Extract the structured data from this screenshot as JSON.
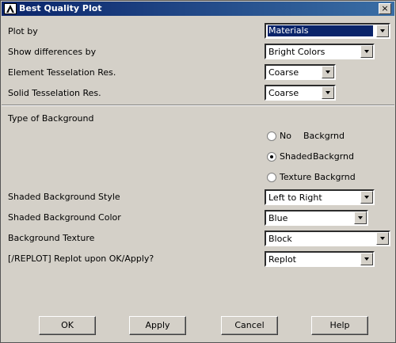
{
  "window": {
    "title": "Best Quality Plot",
    "close_glyph": "×"
  },
  "rows": {
    "plot_by": {
      "label": "Plot by",
      "value": "Materials"
    },
    "show_diff": {
      "label": "Show differences by",
      "value": "Bright Colors"
    },
    "elem_tess": {
      "label": "Element Tesselation Res.",
      "value": "Coarse"
    },
    "solid_tess": {
      "label": "Solid Tesselation Res.",
      "value": "Coarse"
    },
    "bg_type": {
      "label": "Type of Background"
    },
    "shaded_style": {
      "label": "Shaded Background Style",
      "value": "Left to Right"
    },
    "shaded_color": {
      "label": "Shaded Background Color",
      "value": "Blue"
    },
    "bg_texture": {
      "label": "Background Texture",
      "value": "Block"
    },
    "replot": {
      "label": "[/REPLOT] Replot upon OK/Apply?",
      "value": "Replot"
    }
  },
  "radios": [
    {
      "label": "No",
      "label2": "Backgrnd",
      "checked": false
    },
    {
      "label": "Shaded",
      "label2": "Backgrnd",
      "checked": true
    },
    {
      "label": "Texture Backgrnd",
      "label2": "",
      "checked": false
    }
  ],
  "buttons": {
    "ok": "OK",
    "apply": "Apply",
    "cancel": "Cancel",
    "help": "Help"
  },
  "colors": {
    "titlebar": "#0a246a",
    "dialog_bg": "#d4d0c8",
    "selection": "#0a246a"
  }
}
